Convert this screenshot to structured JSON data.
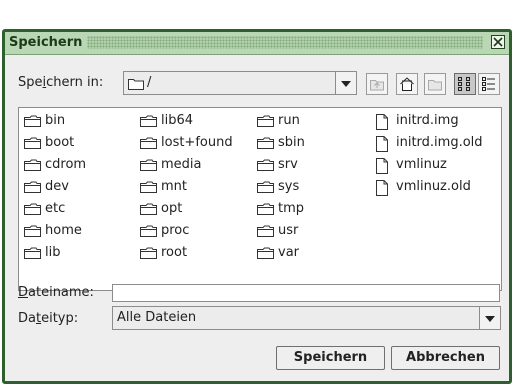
{
  "window": {
    "title": "Speichern"
  },
  "lookin": {
    "label_pre": "Spe",
    "label_mnemonic": "i",
    "label_post": "chern in:",
    "value": "/"
  },
  "files": [
    {
      "name": "bin",
      "type": "folder"
    },
    {
      "name": "boot",
      "type": "folder"
    },
    {
      "name": "cdrom",
      "type": "folder"
    },
    {
      "name": "dev",
      "type": "folder"
    },
    {
      "name": "etc",
      "type": "folder"
    },
    {
      "name": "home",
      "type": "folder"
    },
    {
      "name": "lib",
      "type": "folder"
    },
    {
      "name": "lib64",
      "type": "folder"
    },
    {
      "name": "lost+found",
      "type": "folder"
    },
    {
      "name": "media",
      "type": "folder"
    },
    {
      "name": "mnt",
      "type": "folder"
    },
    {
      "name": "opt",
      "type": "folder"
    },
    {
      "name": "proc",
      "type": "folder"
    },
    {
      "name": "root",
      "type": "folder"
    },
    {
      "name": "run",
      "type": "folder"
    },
    {
      "name": "sbin",
      "type": "folder"
    },
    {
      "name": "srv",
      "type": "folder"
    },
    {
      "name": "sys",
      "type": "folder"
    },
    {
      "name": "tmp",
      "type": "folder"
    },
    {
      "name": "usr",
      "type": "folder"
    },
    {
      "name": "var",
      "type": "folder"
    },
    {
      "name": "initrd.img",
      "type": "file"
    },
    {
      "name": "initrd.img.old",
      "type": "file"
    },
    {
      "name": "vmlinuz",
      "type": "file"
    },
    {
      "name": "vmlinuz.old",
      "type": "file"
    }
  ],
  "filename": {
    "label_mnemonic": "D",
    "label_post": "ateiname:",
    "value": ""
  },
  "filetype": {
    "label_pre": "Da",
    "label_mnemonic": "t",
    "label_post": "eityp:",
    "value": "Alle Dateien"
  },
  "buttons": {
    "save": "Speichern",
    "cancel": "Abbrechen"
  },
  "colors": {
    "border": "#2f5f2c",
    "titlebar": "#b9d7b4"
  }
}
